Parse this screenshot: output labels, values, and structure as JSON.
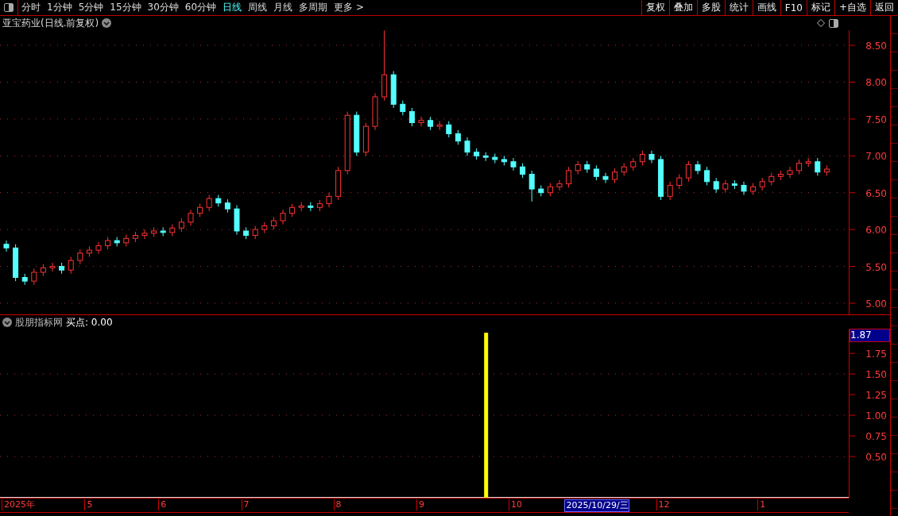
{
  "toolbar": {
    "periods": [
      {
        "label": "分时",
        "selected": false
      },
      {
        "label": "1分钟",
        "selected": false
      },
      {
        "label": "5分钟",
        "selected": false
      },
      {
        "label": "15分钟",
        "selected": false
      },
      {
        "label": "30分钟",
        "selected": false
      },
      {
        "label": "60分钟",
        "selected": false
      },
      {
        "label": "日线",
        "selected": true
      },
      {
        "label": "周线",
        "selected": false
      },
      {
        "label": "月线",
        "selected": false
      },
      {
        "label": "多周期",
        "selected": false
      },
      {
        "label": "更多 >",
        "selected": false
      }
    ],
    "actions": [
      "复权",
      "叠加",
      "多股",
      "统计",
      "画线",
      "F10",
      "标记",
      "+自选",
      "返回"
    ]
  },
  "price_panel": {
    "title": "亚宝药业(日线.前复权)",
    "chart_data": {
      "type": "candlestick",
      "grid": true,
      "ylim": [
        4.849,
        8.705
      ],
      "yticks": [
        {
          "value": 5.0,
          "label": "5.00"
        },
        {
          "value": 5.5,
          "label": "5.50"
        },
        {
          "value": 6.0,
          "label": "6.00"
        },
        {
          "value": 6.5,
          "label": "6.50"
        },
        {
          "value": 7.0,
          "label": "7.00"
        },
        {
          "value": 7.5,
          "label": "7.50"
        },
        {
          "value": 8.0,
          "label": "8.00"
        },
        {
          "value": 8.5,
          "label": "8.50"
        }
      ],
      "ohlc": [
        [
          5.8,
          5.85,
          5.7,
          5.75
        ],
        [
          5.75,
          5.8,
          5.3,
          5.35
        ],
        [
          5.35,
          5.4,
          5.25,
          5.3
        ],
        [
          5.3,
          5.47,
          5.25,
          5.42
        ],
        [
          5.42,
          5.53,
          5.37,
          5.48
        ],
        [
          5.48,
          5.55,
          5.43,
          5.5
        ],
        [
          5.5,
          5.55,
          5.4,
          5.45
        ],
        [
          5.45,
          5.63,
          5.4,
          5.58
        ],
        [
          5.58,
          5.73,
          5.53,
          5.68
        ],
        [
          5.68,
          5.77,
          5.63,
          5.72
        ],
        [
          5.72,
          5.83,
          5.67,
          5.78
        ],
        [
          5.78,
          5.9,
          5.73,
          5.85
        ],
        [
          5.85,
          5.9,
          5.77,
          5.82
        ],
        [
          5.82,
          5.93,
          5.77,
          5.88
        ],
        [
          5.88,
          5.97,
          5.83,
          5.92
        ],
        [
          5.92,
          6.0,
          5.87,
          5.95
        ],
        [
          5.95,
          6.03,
          5.9,
          5.98
        ],
        [
          5.98,
          6.03,
          5.91,
          5.96
        ],
        [
          5.96,
          6.07,
          5.91,
          6.02
        ],
        [
          6.02,
          6.15,
          5.97,
          6.1
        ],
        [
          6.1,
          6.27,
          6.05,
          6.22
        ],
        [
          6.22,
          6.35,
          6.17,
          6.3
        ],
        [
          6.3,
          6.47,
          6.25,
          6.42
        ],
        [
          6.42,
          6.47,
          6.31,
          6.36
        ],
        [
          6.36,
          6.41,
          6.23,
          6.28
        ],
        [
          6.28,
          6.33,
          5.93,
          5.98
        ],
        [
          5.98,
          6.03,
          5.87,
          5.92
        ],
        [
          5.92,
          6.05,
          5.87,
          6.0
        ],
        [
          6.0,
          6.1,
          5.95,
          6.05
        ],
        [
          6.05,
          6.17,
          6.0,
          6.12
        ],
        [
          6.12,
          6.27,
          6.07,
          6.22
        ],
        [
          6.22,
          6.35,
          6.17,
          6.3
        ],
        [
          6.3,
          6.37,
          6.25,
          6.32
        ],
        [
          6.32,
          6.37,
          6.25,
          6.3
        ],
        [
          6.3,
          6.4,
          6.25,
          6.35
        ],
        [
          6.35,
          6.5,
          6.3,
          6.45
        ],
        [
          6.45,
          6.85,
          6.4,
          6.8
        ],
        [
          6.8,
          7.6,
          6.75,
          7.55
        ],
        [
          7.55,
          7.6,
          7.0,
          7.05
        ],
        [
          7.05,
          7.45,
          7.0,
          7.4
        ],
        [
          7.4,
          7.85,
          7.35,
          7.8
        ],
        [
          7.8,
          8.7,
          7.75,
          8.1
        ],
        [
          8.1,
          8.15,
          7.65,
          7.7
        ],
        [
          7.7,
          7.75,
          7.55,
          7.6
        ],
        [
          7.6,
          7.65,
          7.4,
          7.45
        ],
        [
          7.45,
          7.53,
          7.4,
          7.48
        ],
        [
          7.48,
          7.53,
          7.35,
          7.4
        ],
        [
          7.4,
          7.47,
          7.35,
          7.42
        ],
        [
          7.42,
          7.47,
          7.25,
          7.3
        ],
        [
          7.3,
          7.35,
          7.15,
          7.2
        ],
        [
          7.2,
          7.25,
          7.0,
          7.05
        ],
        [
          7.05,
          7.1,
          6.95,
          7.0
        ],
        [
          7.0,
          7.05,
          6.93,
          6.98
        ],
        [
          6.98,
          7.03,
          6.9,
          6.95
        ],
        [
          6.95,
          7.0,
          6.87,
          6.92
        ],
        [
          6.92,
          6.97,
          6.8,
          6.85
        ],
        [
          6.85,
          6.9,
          6.7,
          6.75
        ],
        [
          6.75,
          6.8,
          6.38,
          6.55
        ],
        [
          6.55,
          6.6,
          6.45,
          6.5
        ],
        [
          6.5,
          6.63,
          6.45,
          6.58
        ],
        [
          6.58,
          6.67,
          6.53,
          6.62
        ],
        [
          6.62,
          6.85,
          6.57,
          6.8
        ],
        [
          6.8,
          6.93,
          6.75,
          6.88
        ],
        [
          6.88,
          6.93,
          6.77,
          6.82
        ],
        [
          6.82,
          6.87,
          6.67,
          6.72
        ],
        [
          6.72,
          6.77,
          6.63,
          6.68
        ],
        [
          6.68,
          6.83,
          6.63,
          6.78
        ],
        [
          6.78,
          6.9,
          6.73,
          6.85
        ],
        [
          6.85,
          6.97,
          6.8,
          6.92
        ],
        [
          6.92,
          7.07,
          6.87,
          7.02
        ],
        [
          7.02,
          7.07,
          6.9,
          6.95
        ],
        [
          6.95,
          7.0,
          6.4,
          6.45
        ],
        [
          6.45,
          6.65,
          6.4,
          6.6
        ],
        [
          6.6,
          6.75,
          6.55,
          6.7
        ],
        [
          6.7,
          6.93,
          6.65,
          6.88
        ],
        [
          6.88,
          6.93,
          6.75,
          6.8
        ],
        [
          6.8,
          6.85,
          6.6,
          6.65
        ],
        [
          6.65,
          6.7,
          6.5,
          6.55
        ],
        [
          6.55,
          6.67,
          6.5,
          6.62
        ],
        [
          6.62,
          6.67,
          6.55,
          6.6
        ],
        [
          6.6,
          6.65,
          6.47,
          6.52
        ],
        [
          6.52,
          6.63,
          6.47,
          6.58
        ],
        [
          6.58,
          6.7,
          6.53,
          6.65
        ],
        [
          6.65,
          6.77,
          6.6,
          6.72
        ],
        [
          6.72,
          6.8,
          6.67,
          6.75
        ],
        [
          6.75,
          6.85,
          6.7,
          6.8
        ],
        [
          6.8,
          6.95,
          6.75,
          6.9
        ],
        [
          6.9,
          6.97,
          6.85,
          6.92
        ],
        [
          6.92,
          6.97,
          6.73,
          6.78
        ],
        [
          6.78,
          6.87,
          6.73,
          6.82
        ]
      ]
    }
  },
  "indicator_panel": {
    "source": "股朋指标网",
    "reading": "买点: 0.00",
    "cursor_value": "1.87",
    "cursor_date": "2025/10/29/三",
    "chart_data": {
      "type": "bar",
      "grid": true,
      "ylim": [
        0,
        2.04
      ],
      "yticks": [
        {
          "value": 0.5,
          "label": "0.50"
        },
        {
          "value": 0.75,
          "label": "0.75"
        },
        {
          "value": 1.0,
          "label": "1.00"
        },
        {
          "value": 1.25,
          "label": "1.25"
        },
        {
          "value": 1.5,
          "label": "1.50"
        },
        {
          "value": 1.75,
          "label": "1.75"
        }
      ],
      "series": [
        {
          "color": "#ffff00",
          "values": [
            0,
            0,
            0,
            0,
            0,
            0,
            0,
            0,
            0,
            0,
            0,
            0,
            0,
            0,
            0,
            0,
            0,
            0,
            0,
            0,
            0,
            0,
            0,
            0,
            0,
            0,
            0,
            0,
            0,
            0,
            0,
            0,
            0,
            0,
            0,
            0,
            0,
            0,
            0,
            0,
            0,
            0,
            0,
            0,
            0,
            0,
            0,
            0,
            0,
            0,
            0,
            0,
            2.0,
            0,
            0,
            0,
            0,
            0,
            0,
            0,
            0,
            0,
            0,
            0,
            0,
            0,
            0,
            0,
            0,
            0,
            0,
            0,
            0,
            0,
            0,
            0,
            0,
            0,
            0,
            0,
            0,
            0,
            0,
            0,
            0,
            0,
            0,
            0,
            0,
            0
          ]
        }
      ]
    }
  },
  "time_axis": [
    "2025年",
    "5",
    "6",
    "7",
    "8",
    "9",
    "10",
    "12",
    "1"
  ]
}
